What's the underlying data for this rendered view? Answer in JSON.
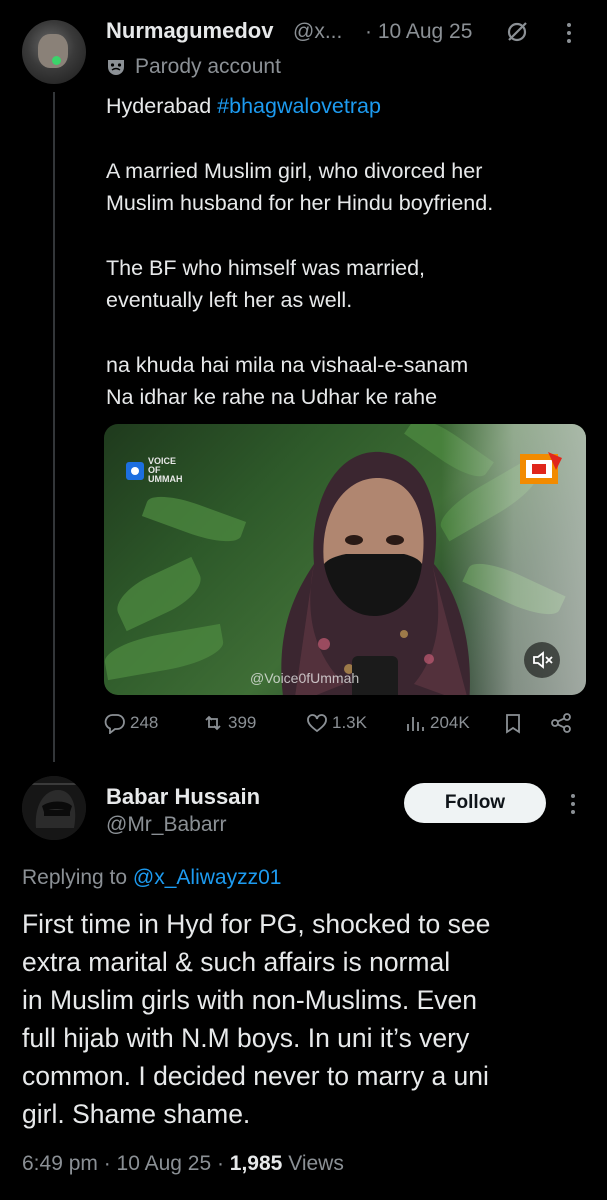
{
  "parent_tweet": {
    "author_name": "Nurmagumedov",
    "handle": "@x...",
    "date": "· 10 Aug 25",
    "label": "Parody account",
    "text": {
      "line1_prefix": "Hyderabad ",
      "line1_hashtag": "#bhagwalovetrap",
      "para1_line1": "A married Muslim girl, who divorced her",
      "para1_line2": "Muslim husband for her Hindu boyfriend.",
      "para2_line1": "The BF who himself was married,",
      "para2_line2": "eventually left her as well.",
      "para3_line1": "na khuda hai mila na vishaal-e-sanam",
      "para3_line2": "Na idhar ke rahe na Udhar ke rahe"
    },
    "media": {
      "logo_text_1": "VOICE",
      "logo_text_2": "OF",
      "logo_text_3": "UMMAH",
      "watermark": "@Voice0fUmmah",
      "mute_icon": "speaker-muted-icon"
    },
    "stats": {
      "replies": "248",
      "reposts": "399",
      "likes": "1.3K",
      "views": "204K"
    }
  },
  "reply_tweet": {
    "author_name": "Babar Hussain",
    "handle": "@Mr_Babarr",
    "follow_label": "Follow",
    "replying_prefix": "Replying to ",
    "replying_mention": "@x_Aliwayzz01",
    "text_lines": [
      "First time in Hyd for PG, shocked to see",
      "extra marital & such affairs is normal",
      "in Muslim girls with non-Muslims. Even",
      "full hijab with N.M boys. In uni it’s very",
      "common. I decided never to marry a uni",
      "girl. Shame shame."
    ],
    "time": "6:49 pm · 10 Aug 25 · ",
    "views_count": "1,985",
    "views_label": " Views"
  },
  "colors": {
    "background": "#000000",
    "text": "#e7e9ea",
    "muted": "#8b9095",
    "link": "#1d9bf0",
    "follow_bg": "#eff3f4"
  }
}
